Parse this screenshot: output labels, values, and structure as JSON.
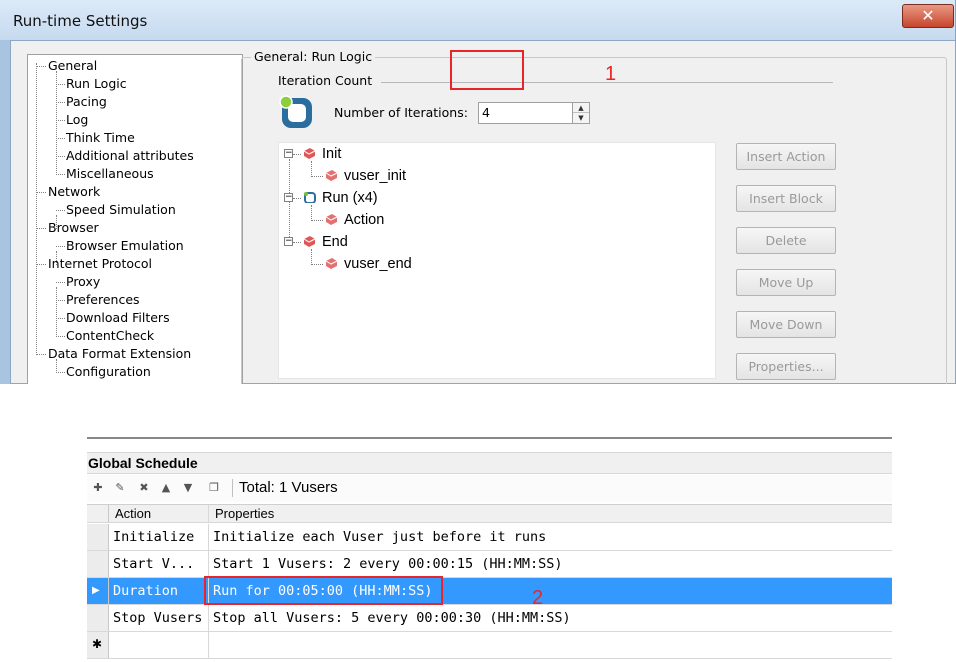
{
  "window": {
    "title": "Run-time Settings",
    "close_label": "✕"
  },
  "tree": {
    "items": [
      {
        "label": "General",
        "level": 0
      },
      {
        "label": "Run Logic",
        "level": 1
      },
      {
        "label": "Pacing",
        "level": 1
      },
      {
        "label": "Log",
        "level": 1
      },
      {
        "label": "Think Time",
        "level": 1
      },
      {
        "label": "Additional attributes",
        "level": 1
      },
      {
        "label": "Miscellaneous",
        "level": 1
      },
      {
        "label": "Network",
        "level": 0
      },
      {
        "label": "Speed Simulation",
        "level": 1
      },
      {
        "label": "Browser",
        "level": 0
      },
      {
        "label": "Browser Emulation",
        "level": 1
      },
      {
        "label": "Internet Protocol",
        "level": 0
      },
      {
        "label": "Proxy",
        "level": 1
      },
      {
        "label": "Preferences",
        "level": 1
      },
      {
        "label": "Download Filters",
        "level": 1
      },
      {
        "label": "ContentCheck",
        "level": 1
      },
      {
        "label": "Data Format Extension",
        "level": 0
      },
      {
        "label": "Configuration",
        "level": 1
      }
    ]
  },
  "run_logic": {
    "group_title": "General: Run Logic",
    "iteration_section": "Iteration Count",
    "num_iterations_label": "Number of Iterations:",
    "num_iterations_value": "4",
    "annotation": "1",
    "logic_tree": [
      {
        "label": "Init",
        "kind": "block"
      },
      {
        "label": "vuser_init",
        "kind": "action"
      },
      {
        "label": "Run (x4)",
        "kind": "run"
      },
      {
        "label": "Action",
        "kind": "action"
      },
      {
        "label": "End",
        "kind": "block"
      },
      {
        "label": "vuser_end",
        "kind": "action"
      }
    ],
    "buttons": [
      {
        "label": "Insert Action",
        "enabled": false
      },
      {
        "label": "Insert Block",
        "enabled": false
      },
      {
        "label": "Delete",
        "enabled": false
      },
      {
        "label": "Move Up",
        "enabled": false
      },
      {
        "label": "Move Down",
        "enabled": false
      },
      {
        "label": "Properties...",
        "enabled": false
      }
    ]
  },
  "schedule": {
    "header": "Global Schedule",
    "total": "Total: 1 Vusers",
    "columns": [
      "Action",
      "Properties"
    ],
    "rows": [
      {
        "action": "Initialize",
        "properties": "Initialize each Vuser just before it runs",
        "selected": false
      },
      {
        "action": "Start  V...",
        "properties": "Start 1 Vusers: 2 every 00:00:15 (HH:MM:SS)",
        "selected": false
      },
      {
        "action": "Duration",
        "properties": "Run for 00:05:00 (HH:MM:SS)",
        "selected": true
      },
      {
        "action": "Stop Vusers",
        "properties": "Stop all Vusers: 5 every 00:00:30 (HH:MM:SS)",
        "selected": false
      }
    ],
    "new_row_marker": "✱",
    "annotation": "2",
    "colors": {
      "selection": "#3399ff",
      "annotation": "#e8262a"
    }
  }
}
